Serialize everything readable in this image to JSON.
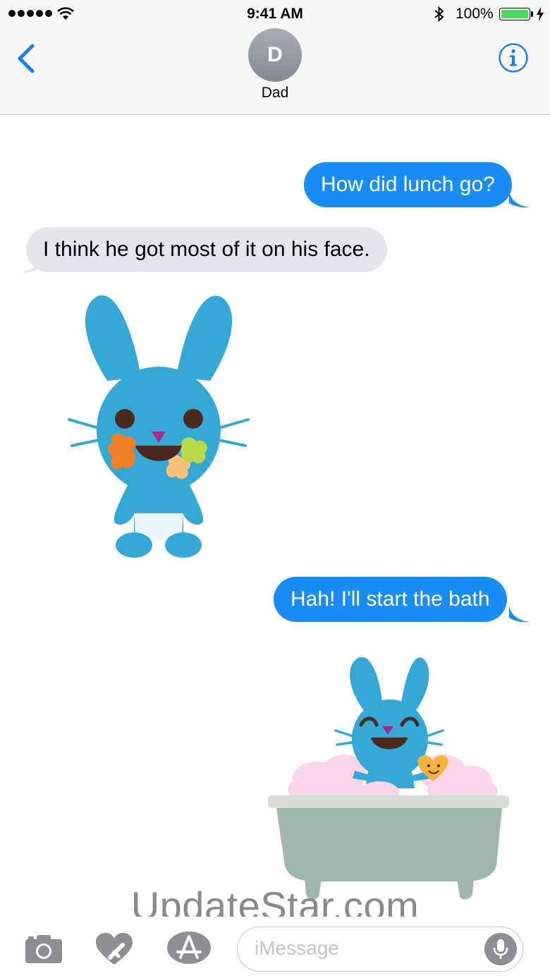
{
  "status_bar": {
    "time": "9:41 AM",
    "battery_percent": "100%"
  },
  "header": {
    "avatar_initial": "D",
    "contact_name": "Dad"
  },
  "messages": [
    {
      "direction": "outgoing",
      "type": "text",
      "text": "How did lunch go?"
    },
    {
      "direction": "incoming",
      "type": "text",
      "text": "I think he got most of it on his face."
    },
    {
      "direction": "incoming",
      "type": "sticker",
      "sticker": "messy-bunny-sticker"
    },
    {
      "direction": "outgoing",
      "type": "text",
      "text": "Hah! I'll start the bath"
    },
    {
      "direction": "outgoing",
      "type": "sticker",
      "sticker": "bath-bunny-sticker"
    }
  ],
  "watermark": "UpdateStar.com",
  "input_bar": {
    "placeholder": "iMessage",
    "icons": [
      "camera-icon",
      "digital-touch-icon",
      "app-store-icon",
      "microphone-icon"
    ]
  },
  "colors": {
    "outgoing_bubble": "#1a8cf5",
    "incoming_bubble": "#e5e5ea",
    "accent": "#1a7ff5",
    "bunny": "#35a8d6"
  }
}
